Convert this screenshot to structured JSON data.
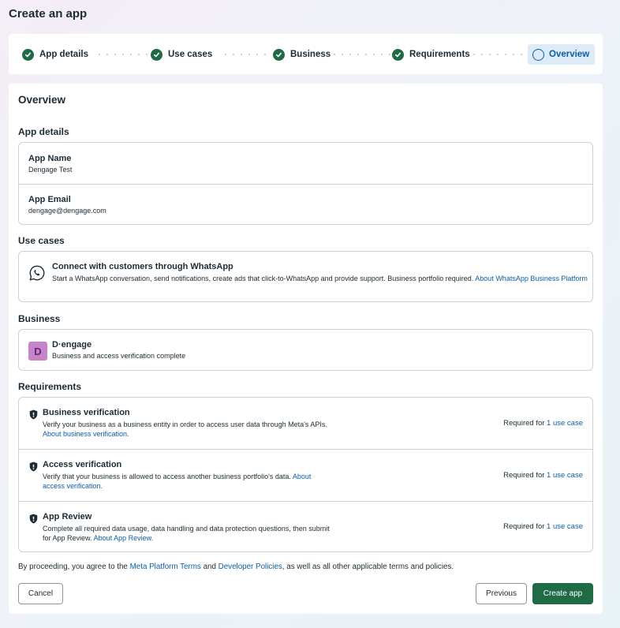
{
  "page": {
    "title": "Create an app"
  },
  "stepper": {
    "steps": [
      {
        "label": "App details",
        "state": "complete"
      },
      {
        "label": "Use cases",
        "state": "complete"
      },
      {
        "label": "Business",
        "state": "complete"
      },
      {
        "label": "Requirements",
        "state": "complete"
      },
      {
        "label": "Overview",
        "state": "current"
      }
    ]
  },
  "overview": {
    "title": "Overview",
    "app_details": {
      "title": "App details",
      "name_label": "App Name",
      "name_value": "Dengage Test",
      "email_label": "App Email",
      "email_value": "dengage@dengage.com"
    },
    "use_cases": {
      "title": "Use cases",
      "item": {
        "icon": "whatsapp-icon",
        "title": "Connect with customers through WhatsApp",
        "desc_line1": "Start a WhatsApp conversation, send notifications, create ads that click-to-WhatsApp and provide support. Business portfolio required.",
        "link_part1": "About WhatsApp Business",
        "link_part2": "Platform"
      }
    },
    "business": {
      "title": "Business",
      "avatar_letter": "D",
      "name": "D·engage",
      "status": "Business and access verification complete"
    },
    "requirements": {
      "title": "Requirements",
      "items": [
        {
          "title": "Business verification",
          "desc": "Verify your business as a business entity in order to access user data through Meta's APIs.",
          "link": "About business verification.",
          "required_prefix": "Required for",
          "required_link": "1 use case"
        },
        {
          "title": "Access verification",
          "desc": "Verify that your business is allowed to access another business portfolio's data.",
          "link_part1": "About",
          "link_part2": "access verification.",
          "required_prefix": "Required for",
          "required_link": "1 use case"
        },
        {
          "title": "App Review",
          "desc_line1": "Complete all required data usage, data handling and data protection questions, then submit",
          "desc_line2": "for App Review.",
          "link": "About App Review.",
          "required_prefix": "Required for",
          "required_link": "1 use case"
        }
      ]
    },
    "terms": {
      "prefix": "By proceeding, you agree to the",
      "link1": "Meta Platform Terms",
      "and": "and",
      "link2": "Developer Policies",
      "suffix": ", as well as all other applicable terms and policies."
    },
    "buttons": {
      "cancel": "Cancel",
      "previous": "Previous",
      "create": "Create app"
    }
  },
  "colors": {
    "primary": "#1f6b45",
    "link": "#0b5da8",
    "border": "#cbd2d9",
    "active_step_bg": "#dcebf7",
    "avatar_bg": "#c884c8"
  }
}
